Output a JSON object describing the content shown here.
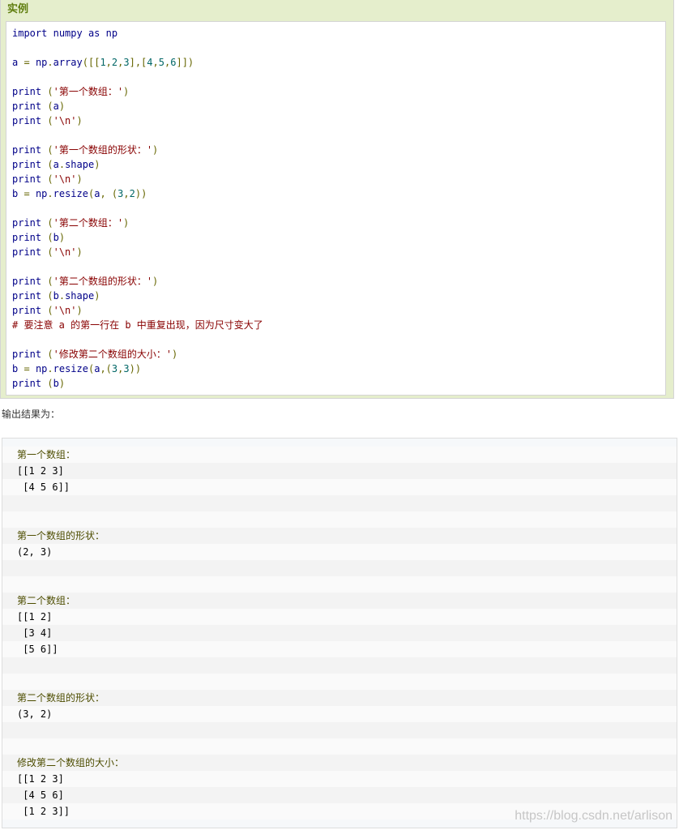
{
  "example": {
    "title": "实例",
    "code_lines": [
      [
        [
          "kw",
          "import"
        ],
        [
          "plain",
          " "
        ],
        [
          "id",
          "numpy"
        ],
        [
          "plain",
          " "
        ],
        [
          "kw",
          "as"
        ],
        [
          "plain",
          " "
        ],
        [
          "id",
          "np"
        ]
      ],
      [],
      [
        [
          "id",
          "a"
        ],
        [
          "plain",
          " "
        ],
        [
          "pun",
          "="
        ],
        [
          "plain",
          " "
        ],
        [
          "id",
          "np"
        ],
        [
          "pun",
          "."
        ],
        [
          "id",
          "array"
        ],
        [
          "pun",
          "([["
        ],
        [
          "num",
          "1"
        ],
        [
          "pun",
          ","
        ],
        [
          "num",
          "2"
        ],
        [
          "pun",
          ","
        ],
        [
          "num",
          "3"
        ],
        [
          "pun",
          "],["
        ],
        [
          "num",
          "4"
        ],
        [
          "pun",
          ","
        ],
        [
          "num",
          "5"
        ],
        [
          "pun",
          ","
        ],
        [
          "num",
          "6"
        ],
        [
          "pun",
          "]])"
        ]
      ],
      [],
      [
        [
          "fn",
          "print"
        ],
        [
          "plain",
          " "
        ],
        [
          "pun",
          "("
        ],
        [
          "str",
          "'第一个数组：'"
        ],
        [
          "pun",
          ")"
        ]
      ],
      [
        [
          "fn",
          "print"
        ],
        [
          "plain",
          " "
        ],
        [
          "pun",
          "("
        ],
        [
          "id",
          "a"
        ],
        [
          "pun",
          ")"
        ]
      ],
      [
        [
          "fn",
          "print"
        ],
        [
          "plain",
          " "
        ],
        [
          "pun",
          "("
        ],
        [
          "str",
          "'\\n'"
        ],
        [
          "pun",
          ")"
        ]
      ],
      [],
      [
        [
          "fn",
          "print"
        ],
        [
          "plain",
          " "
        ],
        [
          "pun",
          "("
        ],
        [
          "str",
          "'第一个数组的形状：'"
        ],
        [
          "pun",
          ")"
        ]
      ],
      [
        [
          "fn",
          "print"
        ],
        [
          "plain",
          " "
        ],
        [
          "pun",
          "("
        ],
        [
          "id",
          "a"
        ],
        [
          "pun",
          "."
        ],
        [
          "id",
          "shape"
        ],
        [
          "pun",
          ")"
        ]
      ],
      [
        [
          "fn",
          "print"
        ],
        [
          "plain",
          " "
        ],
        [
          "pun",
          "("
        ],
        [
          "str",
          "'\\n'"
        ],
        [
          "pun",
          ")"
        ]
      ],
      [
        [
          "id",
          "b"
        ],
        [
          "plain",
          " "
        ],
        [
          "pun",
          "="
        ],
        [
          "plain",
          " "
        ],
        [
          "id",
          "np"
        ],
        [
          "pun",
          "."
        ],
        [
          "id",
          "resize"
        ],
        [
          "pun",
          "("
        ],
        [
          "id",
          "a"
        ],
        [
          "pun",
          ","
        ],
        [
          "plain",
          " "
        ],
        [
          "pun",
          "("
        ],
        [
          "num",
          "3"
        ],
        [
          "pun",
          ","
        ],
        [
          "num",
          "2"
        ],
        [
          "pun",
          "))"
        ]
      ],
      [],
      [
        [
          "fn",
          "print"
        ],
        [
          "plain",
          " "
        ],
        [
          "pun",
          "("
        ],
        [
          "str",
          "'第二个数组：'"
        ],
        [
          "pun",
          ")"
        ]
      ],
      [
        [
          "fn",
          "print"
        ],
        [
          "plain",
          " "
        ],
        [
          "pun",
          "("
        ],
        [
          "id",
          "b"
        ],
        [
          "pun",
          ")"
        ]
      ],
      [
        [
          "fn",
          "print"
        ],
        [
          "plain",
          " "
        ],
        [
          "pun",
          "("
        ],
        [
          "str",
          "'\\n'"
        ],
        [
          "pun",
          ")"
        ]
      ],
      [],
      [
        [
          "fn",
          "print"
        ],
        [
          "plain",
          " "
        ],
        [
          "pun",
          "("
        ],
        [
          "str",
          "'第二个数组的形状：'"
        ],
        [
          "pun",
          ")"
        ]
      ],
      [
        [
          "fn",
          "print"
        ],
        [
          "plain",
          " "
        ],
        [
          "pun",
          "("
        ],
        [
          "id",
          "b"
        ],
        [
          "pun",
          "."
        ],
        [
          "id",
          "shape"
        ],
        [
          "pun",
          ")"
        ]
      ],
      [
        [
          "fn",
          "print"
        ],
        [
          "plain",
          " "
        ],
        [
          "pun",
          "("
        ],
        [
          "str",
          "'\\n'"
        ],
        [
          "pun",
          ")"
        ]
      ],
      [
        [
          "com",
          "# 要注意 a 的第一行在 b 中重复出现，因为尺寸变大了"
        ]
      ],
      [],
      [
        [
          "fn",
          "print"
        ],
        [
          "plain",
          " "
        ],
        [
          "pun",
          "("
        ],
        [
          "str",
          "'修改第二个数组的大小：'"
        ],
        [
          "pun",
          ")"
        ]
      ],
      [
        [
          "id",
          "b"
        ],
        [
          "plain",
          " "
        ],
        [
          "pun",
          "="
        ],
        [
          "plain",
          " "
        ],
        [
          "id",
          "np"
        ],
        [
          "pun",
          "."
        ],
        [
          "id",
          "resize"
        ],
        [
          "pun",
          "("
        ],
        [
          "id",
          "a"
        ],
        [
          "pun",
          ",("
        ],
        [
          "num",
          "3"
        ],
        [
          "pun",
          ","
        ],
        [
          "num",
          "3"
        ],
        [
          "pun",
          "))"
        ]
      ],
      [
        [
          "fn",
          "print"
        ],
        [
          "plain",
          " "
        ],
        [
          "pun",
          "("
        ],
        [
          "id",
          "b"
        ],
        [
          "pun",
          ")"
        ]
      ]
    ]
  },
  "result_caption": "输出结果为：",
  "output_lines": [
    {
      "text": "第一个数组：",
      "kind": "label"
    },
    {
      "text": "[[1 2 3]",
      "kind": "value"
    },
    {
      "text": " [4 5 6]]",
      "kind": "value"
    },
    {
      "text": "",
      "kind": "blank"
    },
    {
      "text": "",
      "kind": "blank"
    },
    {
      "text": "第一个数组的形状：",
      "kind": "label"
    },
    {
      "text": "(2, 3)",
      "kind": "value"
    },
    {
      "text": "",
      "kind": "blank"
    },
    {
      "text": "",
      "kind": "blank"
    },
    {
      "text": "第二个数组：",
      "kind": "label"
    },
    {
      "text": "[[1 2]",
      "kind": "value"
    },
    {
      "text": " [3 4]",
      "kind": "value"
    },
    {
      "text": " [5 6]]",
      "kind": "value"
    },
    {
      "text": "",
      "kind": "blank"
    },
    {
      "text": "",
      "kind": "blank"
    },
    {
      "text": "第二个数组的形状：",
      "kind": "label"
    },
    {
      "text": "(3, 2)",
      "kind": "value"
    },
    {
      "text": "",
      "kind": "blank"
    },
    {
      "text": "",
      "kind": "blank"
    },
    {
      "text": "修改第二个数组的大小：",
      "kind": "label"
    },
    {
      "text": "[[1 2 3]",
      "kind": "value"
    },
    {
      "text": " [4 5 6]",
      "kind": "value"
    },
    {
      "text": " [1 2 3]]",
      "kind": "value"
    }
  ],
  "watermark": "https://blog.csdn.net/arlison",
  "colors": {
    "example_background": "#e5eecc",
    "example_title": "#617f10",
    "keyword": "#000088",
    "string": "#880000",
    "number": "#006666",
    "punctuation": "#666600"
  }
}
